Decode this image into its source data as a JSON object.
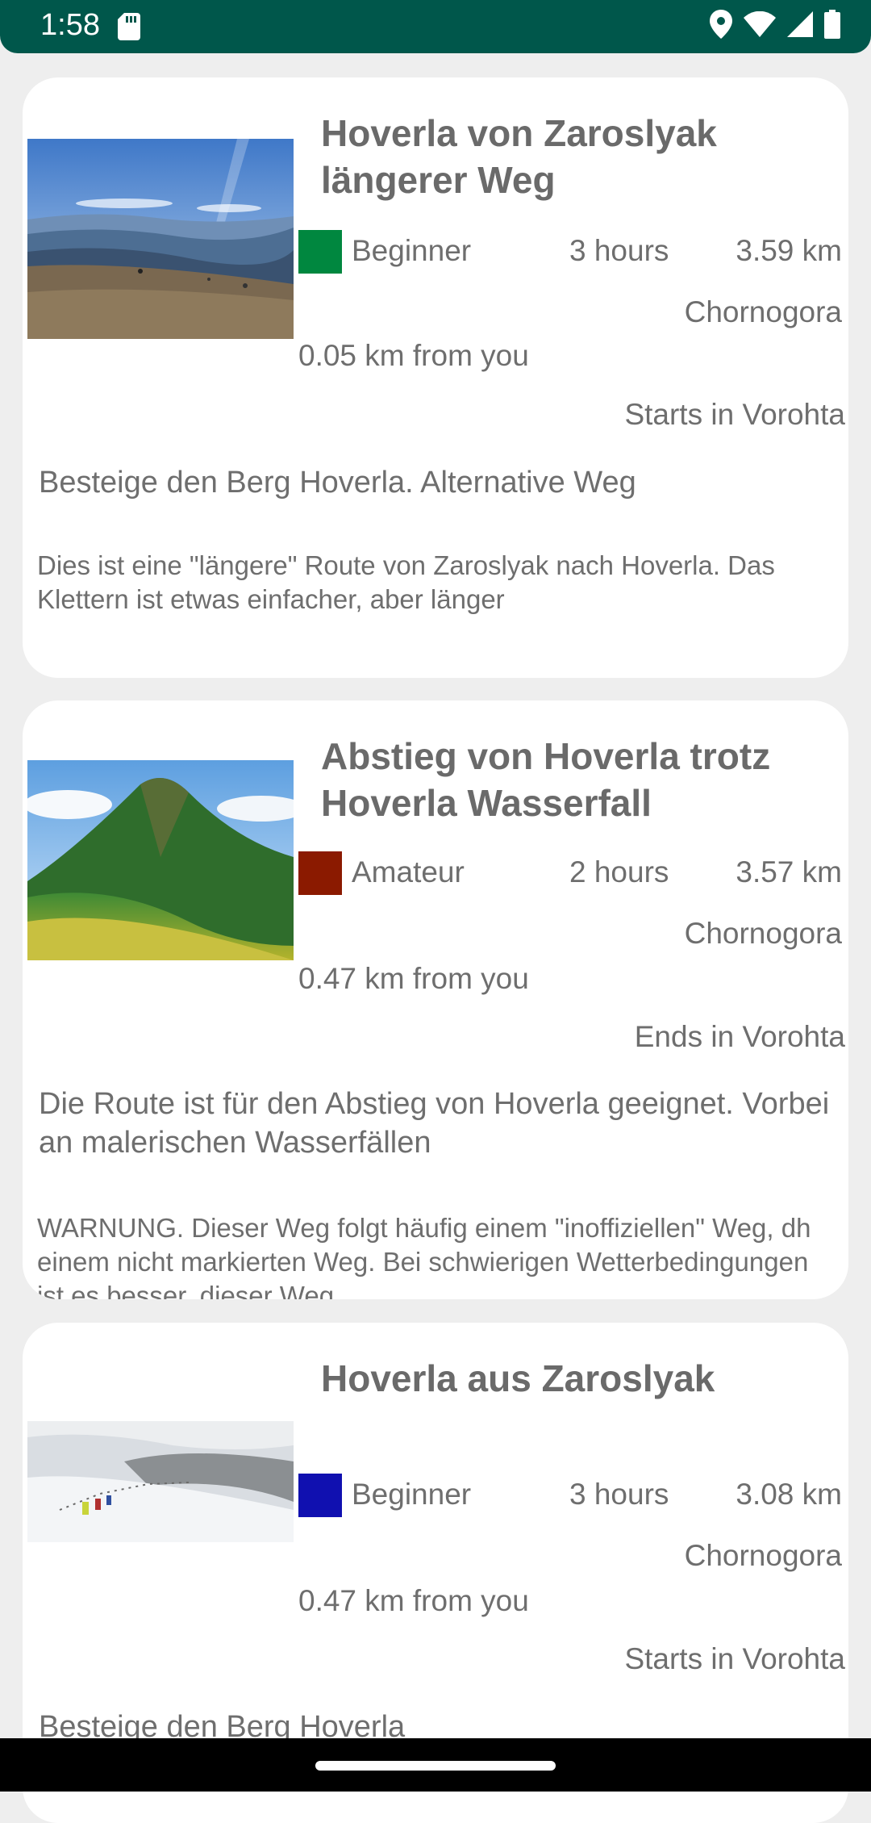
{
  "status_bar": {
    "time": "1:58"
  },
  "routes": [
    {
      "title": "Hoverla von Zaroslyak längerer Weg",
      "difficulty": "Beginner",
      "difficulty_color": "#00873f",
      "duration": "3 hours",
      "distance": "3.59 km",
      "region": "Chornogora",
      "from_you": "0.05 km from you",
      "start_end": "Starts in Vorohta",
      "summary": "Besteige den Berg Hoverla. Alternative Weg",
      "description": "Dies ist eine \"längere\" Route von Zaroslyak nach Hoverla. Das Klettern ist etwas einfacher, aber länger"
    },
    {
      "title": "Abstieg von Hoverla trotz Hoverla Wasserfall",
      "difficulty": "Amateur",
      "difficulty_color": "#8b1a00",
      "duration": "2 hours",
      "distance": "3.57 km",
      "region": "Chornogora",
      "from_you": "0.47 km from you",
      "start_end": "Ends in Vorohta",
      "summary": "Die Route ist für den Abstieg von Hoverla geeignet. Vorbei an malerischen Wasserfällen",
      "description": "WARNUNG. Dieser Weg folgt häufig einem \"inoffiziellen\" Weg, dh einem nicht markierten Weg. Bei schwierigen Wetterbedingungen ist es besser, dieser Weg"
    },
    {
      "title": "Hoverla aus Zaroslyak",
      "difficulty": "Beginner",
      "difficulty_color": "#1010b0",
      "duration": "3 hours",
      "distance": "3.08 km",
      "region": "Chornogora",
      "from_you": "0.47 km from you",
      "start_end": "Starts in Vorohta",
      "summary": "Besteige den Berg Hoverla",
      "description": ""
    }
  ]
}
